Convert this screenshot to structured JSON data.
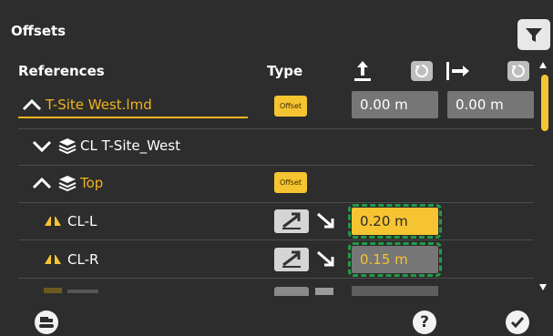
{
  "title": "Offsets",
  "header": {
    "references": "References",
    "type": "Type"
  },
  "rows": [
    {
      "label": "T-Site West.lmd",
      "badge": "Offset",
      "v1": "0.00 m",
      "v2": "0.00 m"
    },
    {
      "label": "CL T-Site_West"
    },
    {
      "label": "Top",
      "badge": "Offset"
    },
    {
      "label": "CL-L",
      "v1": "0.20 m"
    },
    {
      "label": "CL-R",
      "v1": "0.15 m"
    }
  ],
  "icons": {
    "filter": "filter-icon",
    "machine": "machine-icon",
    "help": "help-icon",
    "confirm": "checkmark-icon"
  },
  "colors": {
    "accent": "#f6c431",
    "highlight_outline": "#1f9b48",
    "background": "#2d2d2d"
  }
}
